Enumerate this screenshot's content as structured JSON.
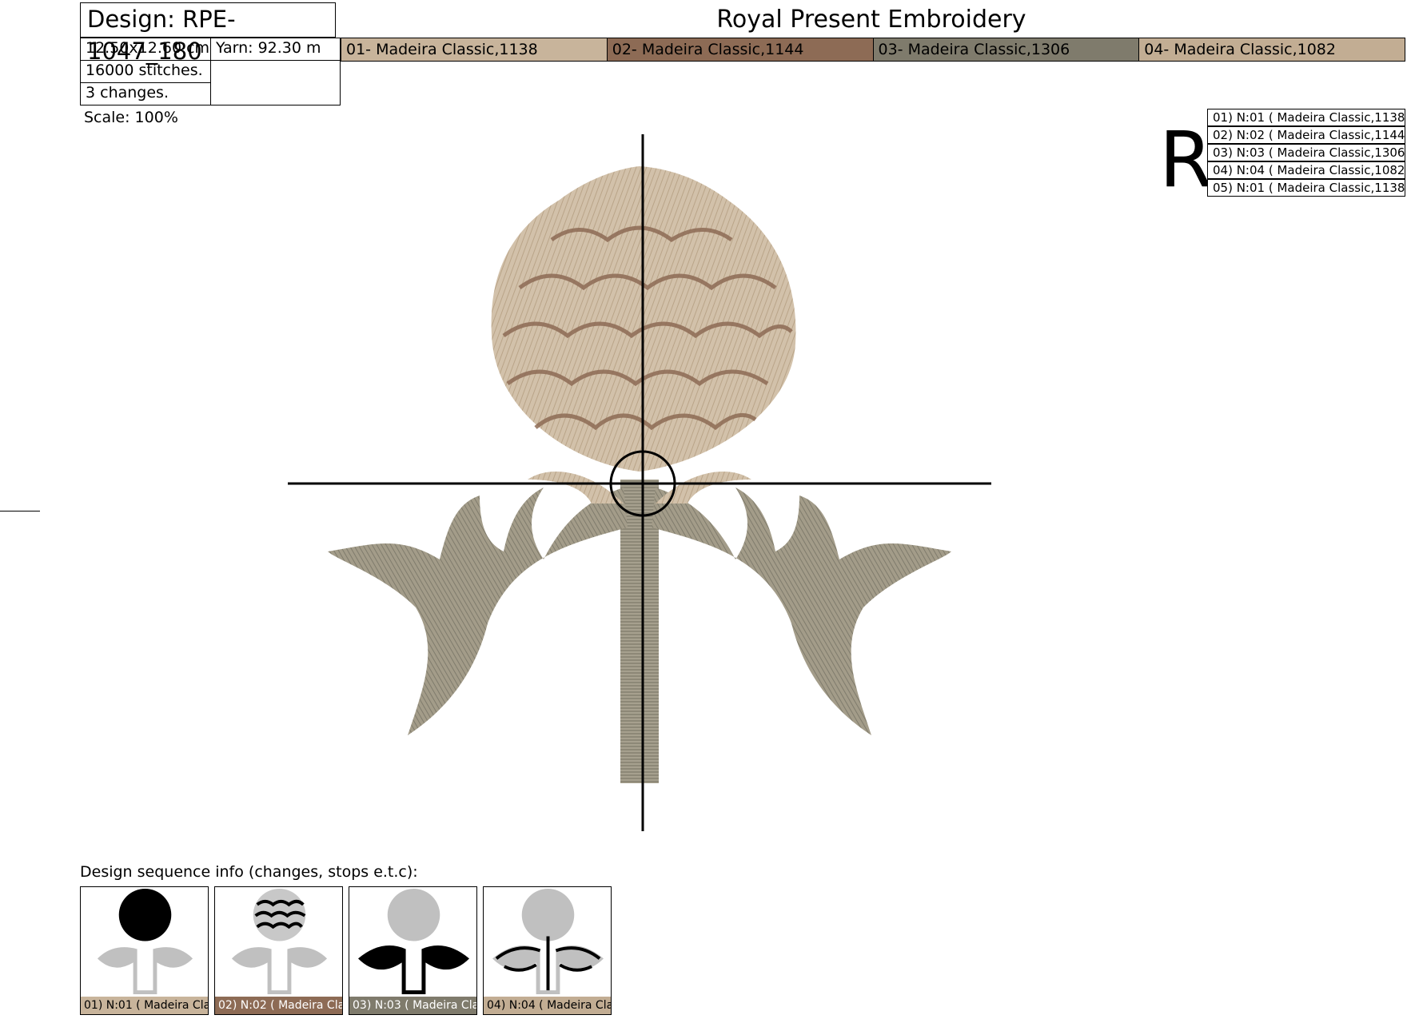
{
  "header": {
    "design_title": "Design: RPE-1047_180",
    "brand": "Royal Present Embroidery",
    "size": "12.50x12.60 cm",
    "yarn": "Yarn: 92.30 m",
    "stitches": "16000 stitches.",
    "changes": "3 changes.",
    "scale": "Scale: 100%"
  },
  "colors": [
    {
      "label": "01- Madeira Classic,1138",
      "hex": "#c8b49b"
    },
    {
      "label": "02- Madeira Classic,1144",
      "hex": "#8d6b55"
    },
    {
      "label": "03- Madeira Classic,1306",
      "hex": "#7f7b6c"
    },
    {
      "label": "04- Madeira Classic,1082",
      "hex": "#c2ad93"
    }
  ],
  "orientation_mark": "R",
  "legend": [
    "01) N:01 ( Madeira Classic,1138)",
    "02) N:02 ( Madeira Classic,1144)",
    "03) N:03 ( Madeira Classic,1306)",
    "04) N:04 ( Madeira Classic,1082)",
    "05) N:01 ( Madeira Classic,1138)"
  ],
  "sequence": {
    "title": "Design sequence info (changes, stops e.t.c):",
    "steps": [
      {
        "caption": "01) N:01 ( Madeira Clas",
        "hex": "#c8b49b"
      },
      {
        "caption": "02) N:02 ( Madeira Clas",
        "hex": "#8d6b55"
      },
      {
        "caption": "03) N:03 ( Madeira Clas",
        "hex": "#7f7b6c"
      },
      {
        "caption": "04) N:04 ( Madeira Clas",
        "hex": "#c2ad93"
      }
    ]
  }
}
